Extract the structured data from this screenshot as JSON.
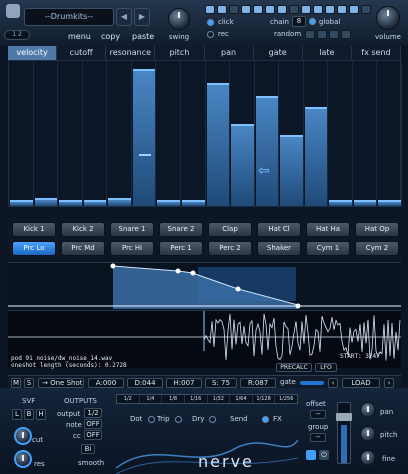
{
  "top": {
    "preset_name": "--Drumkits--",
    "prev": "◀",
    "next": "▶",
    "menu": "menu",
    "copy": "copy",
    "paste": "paste",
    "swing": "swing",
    "click": "click",
    "rec": "rec",
    "chain_label": "chain",
    "chain_value": "8",
    "global": "global",
    "random": "random",
    "volume": "volume",
    "page_indicator": "1 2"
  },
  "tabs": [
    "velocity",
    "cutoff",
    "resonance",
    "pitch",
    "pan",
    "gate",
    "late",
    "fx send"
  ],
  "active_tab": "velocity",
  "steps": {
    "count": 16,
    "levels": [
      0.04,
      0.06,
      0.04,
      0.04,
      0.06,
      0.97,
      0.04,
      0.04,
      0.87,
      0.58,
      0.78,
      0.5,
      0.7,
      0.04,
      0.04,
      0.04
    ],
    "marker": "⇦"
  },
  "pads": [
    [
      "Kick 1",
      "Kick 2",
      "Snare 1",
      "Snare 2",
      "Clap",
      "Hat Cl",
      "Hat Ha",
      "Hat Op"
    ],
    [
      "Prc Lo",
      "Prc Md",
      "Prc Hi",
      "Perc 1",
      "Perc 2",
      "Shaker",
      "Cym 1",
      "Cym 2"
    ]
  ],
  "selected_pad": "Prc Lo",
  "info": {
    "pod_label": "pod",
    "pod_number": "91",
    "file": "noise/dw_noise_14.wav",
    "oneshot_label": "oneshot length (seconds):",
    "oneshot_value": "0.2728",
    "start": "START: 3247",
    "precalc": "PRECALC",
    "lfo": "LFO"
  },
  "controls": {
    "m": "M",
    "s": "S",
    "mode": "One Shot",
    "a": "A:000",
    "d": "D:044",
    "h": "H:007",
    "s_val": "S: 75",
    "r": "R:087",
    "gate": "gate",
    "load": "LOAD"
  },
  "svf": {
    "title": "SVF",
    "l": "L",
    "b": "B",
    "h": "H",
    "cut": "cut",
    "res": "res"
  },
  "outputs": {
    "title": "OUTPUTS",
    "output_label": "output",
    "output_value": "1/2",
    "note_label": "note",
    "note_value": "OFF",
    "cc_label": "cc",
    "cc_value": "OFF",
    "smooth_value": "Bi",
    "smooth_label": "smooth"
  },
  "fx": {
    "divisions": [
      "1/2",
      "1/4",
      "1/8",
      "1/16",
      "1/32",
      "1/64",
      "1/128",
      "1/256"
    ],
    "dot": "Dot",
    "trip": "Trip",
    "dry": "Dry",
    "send": "Send",
    "fx": "FX",
    "logo": "nerve"
  },
  "right": {
    "offset": "offset",
    "offset_val": "--",
    "group": "group",
    "group_val": "--",
    "pan": "pan",
    "pitch": "pitch",
    "fine": "fine"
  },
  "colors": {
    "accent": "#3fa0ff",
    "bg": "#0b1524"
  }
}
